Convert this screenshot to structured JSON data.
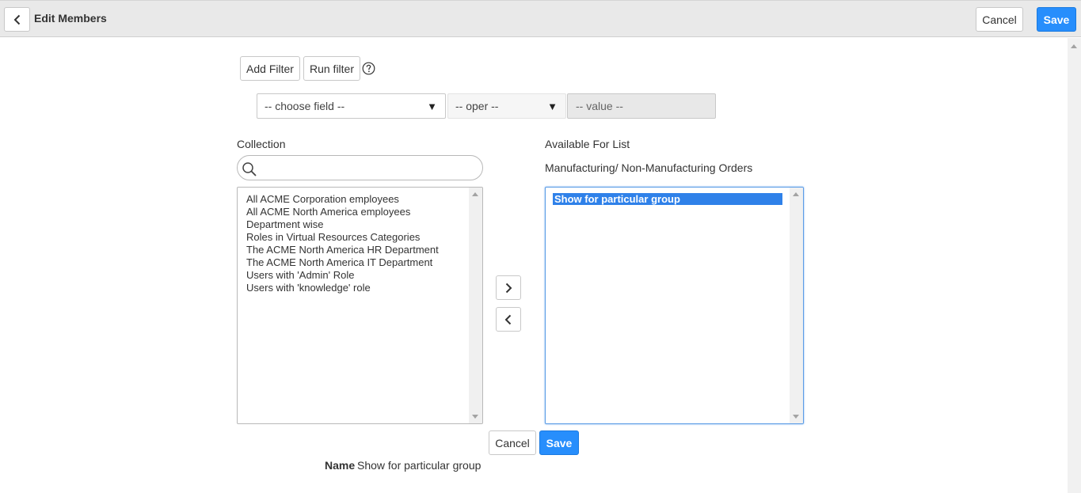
{
  "header": {
    "title": "Edit Members",
    "cancel_label": "Cancel",
    "save_label": "Save"
  },
  "filter": {
    "add_filter_label": "Add Filter",
    "run_filter_label": "Run filter",
    "field_select": "-- choose field --",
    "oper_select": "-- oper --",
    "value_placeholder": "-- value --"
  },
  "collection": {
    "label": "Collection",
    "search_value": "",
    "items": [
      "All ACME Corporation employees",
      "All ACME North America employees",
      "Department wise",
      "Roles in Virtual Resources Categories",
      "The ACME North America HR Department",
      "The ACME North America IT Department",
      "Users with 'Admin' Role",
      "Users with 'knowledge' role"
    ]
  },
  "available": {
    "label": "Available For List",
    "list_name": "Manufacturing/ Non-Manufacturing Orders",
    "items": [
      "Show for particular group"
    ]
  },
  "footer": {
    "cancel_label": "Cancel",
    "save_label": "Save",
    "name_label": "Name",
    "name_value": "Show for particular group"
  },
  "icons": {
    "back": "chevron-left-icon",
    "help": "question-circle-icon",
    "search": "search-icon",
    "add": "chevron-right-icon",
    "remove": "chevron-left-icon"
  },
  "colors": {
    "primary": "#278efc",
    "header_bg": "#e9e9e9",
    "selection": "#2f81e9"
  }
}
